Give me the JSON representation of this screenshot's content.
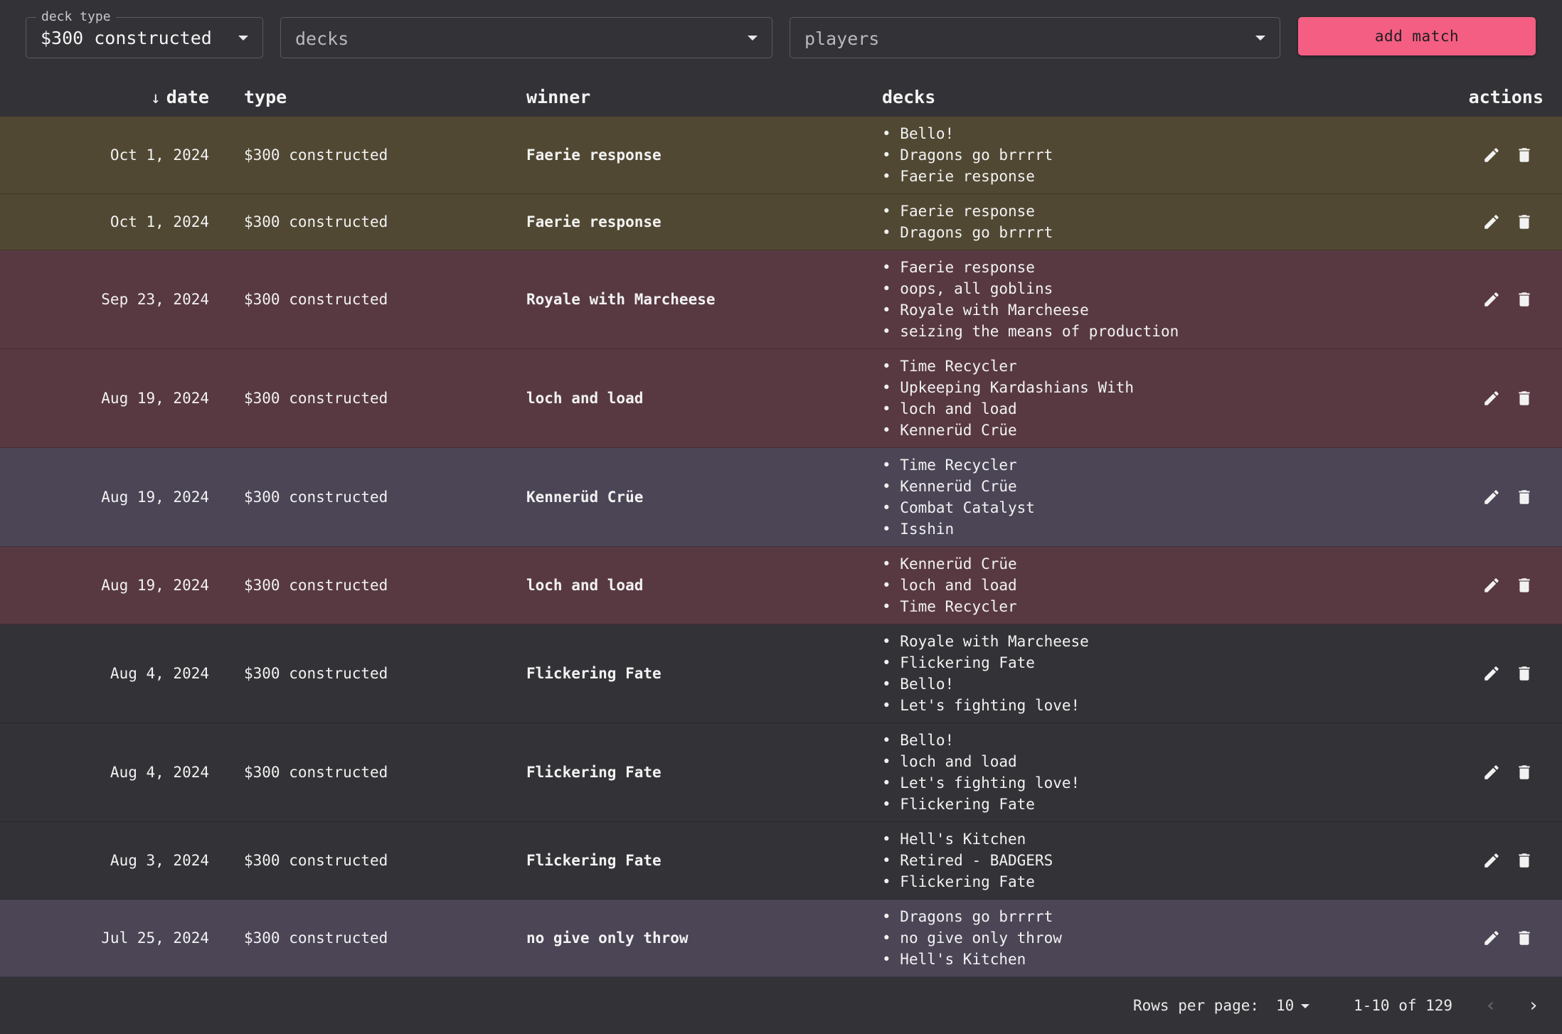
{
  "filters": {
    "deck_type": {
      "label": "deck type",
      "value": "$300 constructed"
    },
    "decks": {
      "placeholder": "decks"
    },
    "players": {
      "placeholder": "players"
    },
    "add_match_label": "add match"
  },
  "table": {
    "headers": {
      "date": "date",
      "type": "type",
      "winner": "winner",
      "decks": "decks",
      "actions": "actions"
    },
    "sort_icon": "arrow-down-icon",
    "rows": [
      {
        "date": "Oct 1, 2024",
        "type": "$300 constructed",
        "winner": "Faerie response",
        "decks": [
          "Bello!",
          "Dragons go brrrrt",
          "Faerie response"
        ],
        "bg": "#514833"
      },
      {
        "date": "Oct 1, 2024",
        "type": "$300 constructed",
        "winner": "Faerie response",
        "decks": [
          "Faerie response",
          "Dragons go brrrrt"
        ],
        "bg": "#514833"
      },
      {
        "date": "Sep 23, 2024",
        "type": "$300 constructed",
        "winner": "Royale with Marcheese",
        "decks": [
          "Faerie response",
          "oops, all goblins",
          "Royale with Marcheese",
          "seizing the means of production"
        ],
        "bg": "#583942"
      },
      {
        "date": "Aug 19, 2024",
        "type": "$300 constructed",
        "winner": "loch and load",
        "decks": [
          "Time Recycler",
          "Upkeeping Kardashians With",
          "loch and load",
          "Kennerüd Crüe"
        ],
        "bg": "#583942"
      },
      {
        "date": "Aug 19, 2024",
        "type": "$300 constructed",
        "winner": "Kennerüd Crüe",
        "decks": [
          "Time Recycler",
          "Kennerüd Crüe",
          "Combat Catalyst",
          "Isshin"
        ],
        "bg": "#4b4556"
      },
      {
        "date": "Aug 19, 2024",
        "type": "$300 constructed",
        "winner": "loch and load",
        "decks": [
          "Kennerüd Crüe",
          "loch and load",
          "Time Recycler"
        ],
        "bg": "#583942"
      },
      {
        "date": "Aug 4, 2024",
        "type": "$300 constructed",
        "winner": "Flickering Fate",
        "decks": [
          "Royale with Marcheese",
          "Flickering Fate",
          "Bello!",
          "Let's fighting love!"
        ],
        "bg": "#333236"
      },
      {
        "date": "Aug 4, 2024",
        "type": "$300 constructed",
        "winner": "Flickering Fate",
        "decks": [
          "Bello!",
          "loch and load",
          "Let's fighting love!",
          "Flickering Fate"
        ],
        "bg": "#333236"
      },
      {
        "date": "Aug 3, 2024",
        "type": "$300 constructed",
        "winner": "Flickering Fate",
        "decks": [
          "Hell's Kitchen",
          "Retired - BADGERS",
          "Flickering Fate"
        ],
        "bg": "#333236"
      },
      {
        "date": "Jul 25, 2024",
        "type": "$300 constructed",
        "winner": "no give only throw",
        "decks": [
          "Dragons go brrrrt",
          "no give only throw",
          "Hell's Kitchen"
        ],
        "bg": "#4b4556"
      }
    ]
  },
  "pagination": {
    "rows_per_page_label": "Rows per page:",
    "rows_per_page_value": "10",
    "range_label": "1-10 of 129",
    "prev_icon": "chevron-left-icon",
    "next_icon": "chevron-right-icon"
  }
}
